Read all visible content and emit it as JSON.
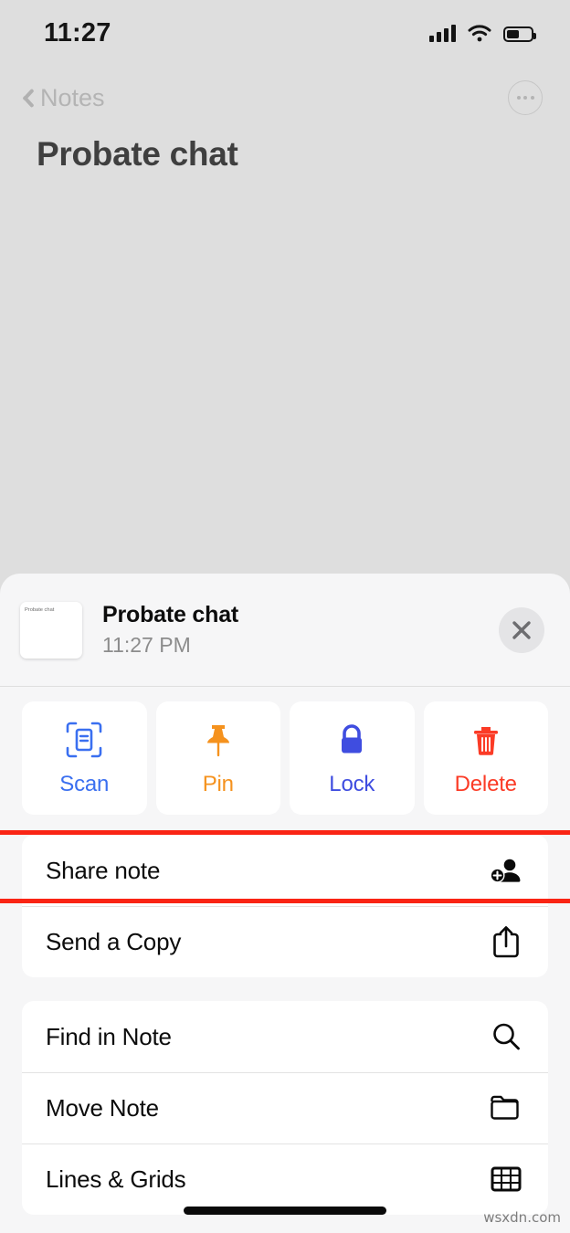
{
  "status_bar": {
    "time": "11:27",
    "signal_icon": "cellular-signal-icon",
    "wifi_icon": "wifi-icon",
    "battery_icon": "battery-icon",
    "battery_level_pct": 45
  },
  "nav": {
    "back_label": "Notes",
    "back_icon": "chevron-left-icon",
    "more_icon": "ellipsis-circle-icon"
  },
  "note": {
    "title": "Probate chat"
  },
  "sheet": {
    "header": {
      "thumbnail_text": "Probate chat",
      "title": "Probate chat",
      "subtitle": "11:27 PM",
      "close_icon": "close-icon"
    },
    "tiles": [
      {
        "label": "Scan",
        "icon": "document-scan-icon",
        "color": "#3a6ff0"
      },
      {
        "label": "Pin",
        "icon": "pushpin-icon",
        "color": "#f5921e"
      },
      {
        "label": "Lock",
        "icon": "lock-icon",
        "color": "#3f4de0"
      },
      {
        "label": "Delete",
        "icon": "trash-icon",
        "color": "#fb3b26"
      }
    ],
    "groups": [
      {
        "rows": [
          {
            "label": "Share note",
            "icon": "person-add-icon",
            "highlighted": true
          },
          {
            "label": "Send a Copy",
            "icon": "share-upload-icon",
            "highlighted": false
          }
        ]
      },
      {
        "rows": [
          {
            "label": "Find in Note",
            "icon": "search-icon",
            "highlighted": false
          },
          {
            "label": "Move Note",
            "icon": "folder-icon",
            "highlighted": false
          },
          {
            "label": "Lines & Grids",
            "icon": "grid-icon",
            "highlighted": false
          }
        ]
      }
    ]
  },
  "annotation": {
    "highlight_color": "#fa2414",
    "target": "Share note"
  },
  "watermark": "wsxdn.com",
  "colors": {
    "page_background": "#dedede",
    "sheet_background": "#f6f6f7",
    "card_background": "#ffffff",
    "title_text": "#3f3f3f"
  }
}
